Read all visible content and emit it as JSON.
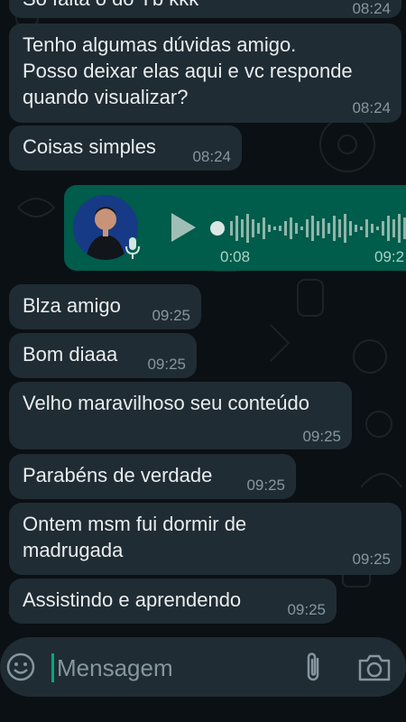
{
  "chat": {
    "partial_top": {
      "text": "Só falta o do Yb kkk",
      "time": "08:24"
    },
    "messages": [
      {
        "text": "Tenho algumas dúvidas amigo.\nPosso deixar elas aqui e vc responde\nquando visualizar?",
        "time": "08:24"
      },
      {
        "text": "Coisas simples",
        "time": "08:24"
      },
      {
        "text": "Blza amigo",
        "time": "09:25"
      },
      {
        "text": "Bom diaaa",
        "time": "09:25"
      },
      {
        "text": "Velho maravilhoso seu conteúdo",
        "time": "09:25"
      },
      {
        "text": "Parabéns de verdade",
        "time": "09:25"
      },
      {
        "text": "Ontem msm fui dormir de\nmadrugada",
        "time": "09:25"
      },
      {
        "text": "Assistindo e aprendendo",
        "time": "09:25"
      }
    ],
    "voice_message": {
      "duration": "0:08",
      "time": "09:2",
      "icons": [
        "avatar",
        "mic-icon",
        "play-icon"
      ]
    }
  },
  "input": {
    "placeholder": "Mensagem",
    "icons": [
      "emoji-icon",
      "attach-icon",
      "camera-icon"
    ]
  },
  "colors": {
    "background": "#0b1014",
    "incoming_bubble": "#202c33",
    "outgoing_bubble": "#005c4b",
    "text": "#e9edef",
    "meta": "#8696a0",
    "accent": "#00a884"
  }
}
